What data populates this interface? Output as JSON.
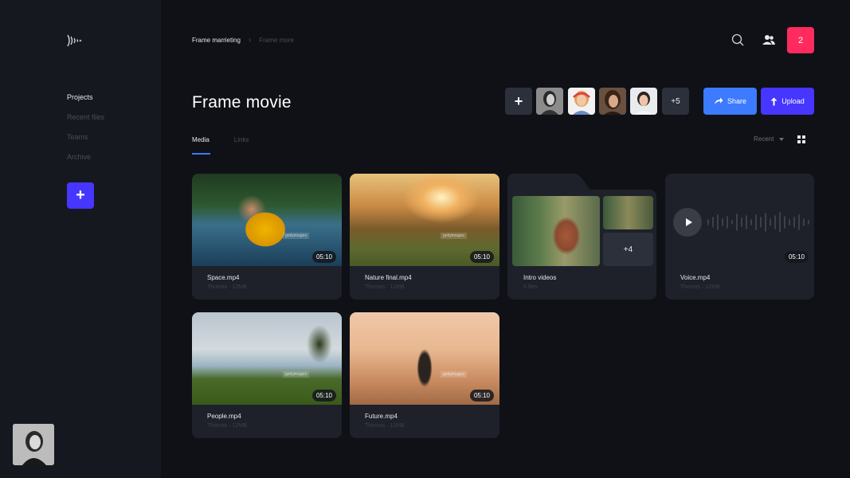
{
  "sidebar": {
    "logo_icon": "sound-waves-logo",
    "nav": [
      {
        "label": "Projects",
        "active": true
      },
      {
        "label": "Recent files",
        "active": false
      },
      {
        "label": "Teams",
        "active": false
      },
      {
        "label": "Archive",
        "active": false
      }
    ],
    "add_label": "+"
  },
  "header": {
    "breadcrumb": [
      "Frame marrieting",
      "Frame more"
    ],
    "search_icon": "search-icon",
    "users_icon": "users-icon",
    "notification_count": "2"
  },
  "page": {
    "title": "Frame movie",
    "add_member_label": "+",
    "more_members": "+5",
    "share_label": "Share",
    "upload_label": "Upload"
  },
  "tabs": [
    {
      "label": "Media",
      "active": true
    },
    {
      "label": "Links",
      "active": false
    }
  ],
  "sort": {
    "label": "Recent"
  },
  "media": [
    {
      "name": "Space.mp4",
      "meta": "Thomas · 12MB",
      "duration": "05:10",
      "watermark": "gettyimages"
    },
    {
      "name": "Nature final.mp4",
      "meta": "Thomas · 12MB",
      "duration": "05:10",
      "watermark": "gettyimages"
    },
    {
      "name": "Intro videos",
      "meta": "5 files",
      "more": "+4"
    },
    {
      "name": "Voice.mp4",
      "meta": "Thomas · 12MB",
      "duration": "05:10"
    },
    {
      "name": "People.mp4",
      "meta": "Thomas · 12MB",
      "duration": "05:10",
      "watermark": "gettyimages"
    },
    {
      "name": "Future.mp4",
      "meta": "Thomas · 12MB",
      "duration": "05:10",
      "watermark": "gettyimages"
    }
  ],
  "colors": {
    "background": "#0f1117",
    "sidebar": "#16181f",
    "card": "#1e212a",
    "primary": "#4636ff",
    "share": "#3c7bff",
    "notification": "#ff2b5e"
  }
}
